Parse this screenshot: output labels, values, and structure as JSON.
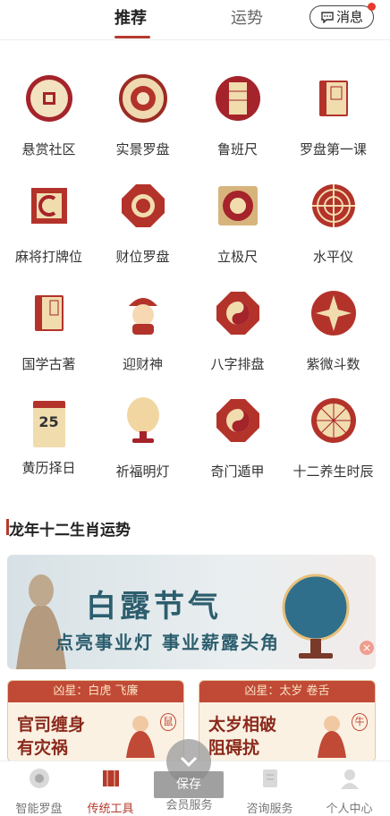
{
  "header": {
    "tabs": [
      {
        "label": "推荐",
        "active": true
      },
      {
        "label": "运势",
        "active": false
      }
    ],
    "message_label": "消息",
    "message_has_dot": true
  },
  "tools": [
    {
      "label": "悬赏社区",
      "icon": "coin-community-icon"
    },
    {
      "label": "实景罗盘",
      "icon": "compass-icon"
    },
    {
      "label": "鲁班尺",
      "icon": "luban-ruler-icon"
    },
    {
      "label": "罗盘第一课",
      "icon": "book-icon"
    },
    {
      "label": "麻将打牌位",
      "icon": "mahjong-icon"
    },
    {
      "label": "财位罗盘",
      "icon": "wealth-compass-icon"
    },
    {
      "label": "立极尺",
      "icon": "pole-ruler-icon"
    },
    {
      "label": "水平仪",
      "icon": "level-icon"
    },
    {
      "label": "国学古著",
      "icon": "classics-book-icon"
    },
    {
      "label": "迎财神",
      "icon": "god-of-wealth-icon"
    },
    {
      "label": "八字排盘",
      "icon": "yin-yang-icon"
    },
    {
      "label": "紫微斗数",
      "icon": "ziwei-star-icon"
    },
    {
      "label": "黄历择日",
      "icon": "calendar-icon"
    },
    {
      "label": "祈福明灯",
      "icon": "lamp-icon"
    },
    {
      "label": "奇门遁甲",
      "icon": "qimen-icon"
    },
    {
      "label": "十二养生时辰",
      "icon": "twelve-hours-icon"
    }
  ],
  "calendar_icon_day": "25",
  "section": {
    "title": "龙年十二生肖运势"
  },
  "banner": {
    "title": "白露节气",
    "subtitle": "点亮事业灯 事业薪露头角"
  },
  "cards": [
    {
      "header": "凶星：白虎 飞廉",
      "line1": "官司缠身",
      "line2": "有灾祸",
      "zodiac": "鼠"
    },
    {
      "header": "凶星：太岁 卷舌",
      "line1": "太岁相破",
      "line2": "阻碍扰",
      "zodiac": "牛"
    }
  ],
  "save_label": "保存",
  "nav": [
    {
      "label": "智能罗盘",
      "icon": "smart-compass-icon",
      "active": false
    },
    {
      "label": "传统工具",
      "icon": "traditional-tools-icon",
      "active": true
    },
    {
      "label": "会员服务",
      "icon": "member-icon",
      "active": false
    },
    {
      "label": "咨询服务",
      "icon": "consult-icon",
      "active": false
    },
    {
      "label": "个人中心",
      "icon": "profile-icon",
      "active": false
    }
  ],
  "colors": {
    "accent": "#b53a2c",
    "card_header": "#c04a36",
    "banner_text": "#2c5e6e"
  }
}
